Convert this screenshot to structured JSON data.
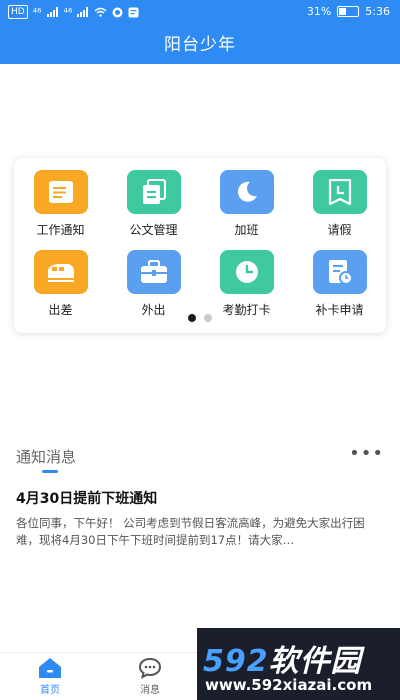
{
  "status_bar": {
    "left_chip": "HD",
    "signal_1": "⁴⁶",
    "signal_2": "⁴⁶",
    "battery": "31%",
    "time": "5:36"
  },
  "header": {
    "title": "阳台少年"
  },
  "functions": [
    {
      "label": "工作通知",
      "icon": "document-icon",
      "color": "#f9a825"
    },
    {
      "label": "公文管理",
      "icon": "files-icon",
      "color": "#3ec9a0"
    },
    {
      "label": "加班",
      "icon": "moon-icon",
      "color": "#5a9ff0"
    },
    {
      "label": "请假",
      "icon": "calendar-leave-icon",
      "color": "#3ec9a0"
    },
    {
      "label": "出差",
      "icon": "train-icon",
      "color": "#f9a825"
    },
    {
      "label": "外出",
      "icon": "briefcase-icon",
      "color": "#5a9ff0"
    },
    {
      "label": "考勤打卡",
      "icon": "clock-icon",
      "color": "#3ec9a0"
    },
    {
      "label": "补卡申请",
      "icon": "form-clock-icon",
      "color": "#5a9ff0"
    }
  ],
  "pager": {
    "pages": 2,
    "current": 1
  },
  "notices": {
    "section_title": "通知消息",
    "more": "•••",
    "item": {
      "title": "4月30日提前下班通知",
      "body": "各位同事，下午好！ 公司考虑到节假日客流高峰，为避免大家出行困难，现将4月30日下午下班时间提前到17点！请大家…"
    }
  },
  "tabs": [
    {
      "label": "首页",
      "icon": "home-icon",
      "active": true
    },
    {
      "label": "消息",
      "icon": "chat-bubble-icon",
      "active": false
    }
  ],
  "watermark": {
    "brand_num": "592",
    "brand_text": "软件园",
    "url": "www.592xiazai.com"
  },
  "colors": {
    "primary": "#2f8bf4",
    "orange": "#f9a825",
    "teal": "#3ec9a0",
    "blue": "#5a9ff0"
  }
}
